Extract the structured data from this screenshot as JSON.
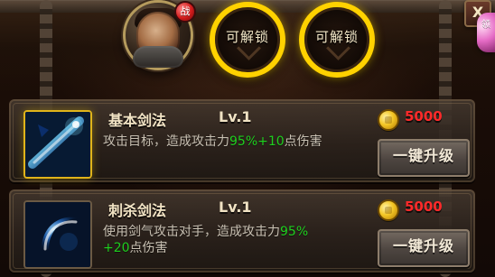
{
  "top": {
    "avatar_badge": "战",
    "slots": [
      {
        "label": "可解锁"
      },
      {
        "label": "可解锁"
      }
    ],
    "close_label": "X",
    "side_tab_text": "领"
  },
  "skills": [
    {
      "name": "基本剑法",
      "level": "Lv.1",
      "desc_pre": "攻击目标，造成攻击力",
      "desc_percent": "95%",
      "desc_plus": "+10",
      "desc_post": "点伤害",
      "cost": "5000",
      "button_label": "一键升级"
    },
    {
      "name": "刺杀剑法",
      "level": "Lv.1",
      "desc_pre": "使用剑气攻击对手，造成攻击力",
      "desc_percent": "95%",
      "desc_plus": "+20",
      "desc_post": "点伤害",
      "cost": "5000",
      "button_label": "一键升级"
    }
  ],
  "colors": {
    "gold": "#ffd200",
    "green": "#1fcf1f",
    "red_cost": "#ff2a2a"
  }
}
